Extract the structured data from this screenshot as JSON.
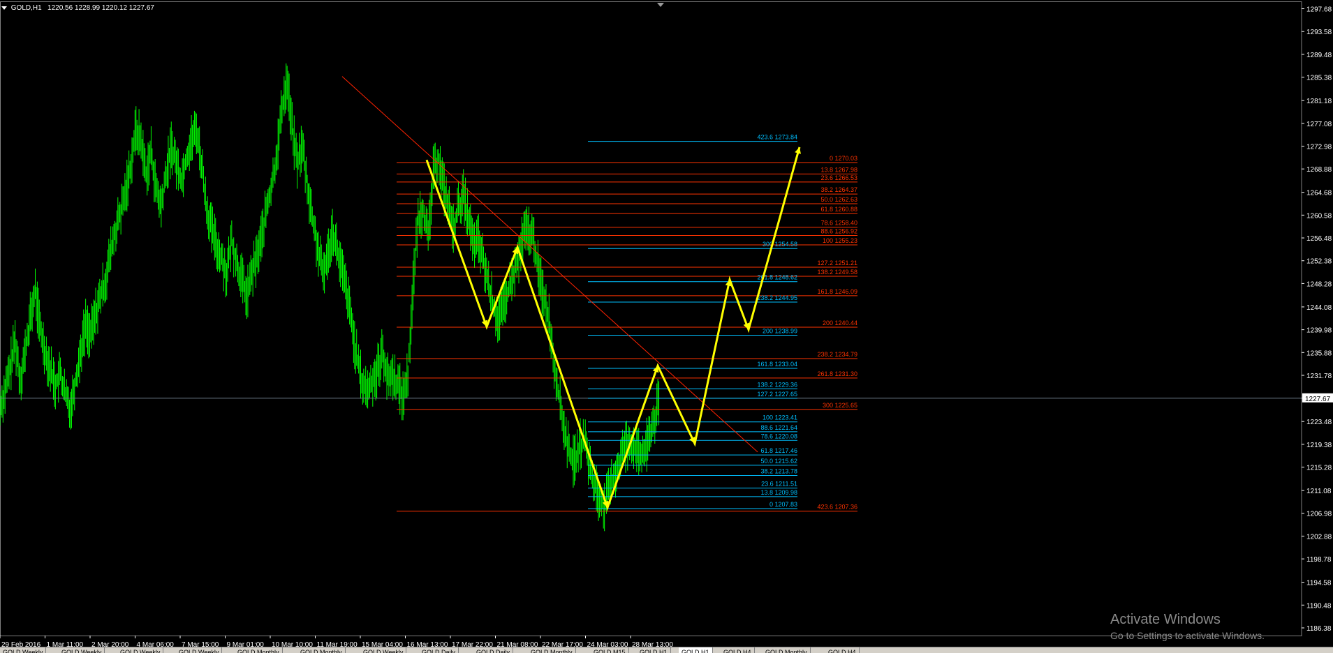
{
  "symbol_label": "GOLD,H1",
  "ohlc_label": "1220.56 1228.99 1220.12 1227.67",
  "current_price_label": "1227.67",
  "watermark": {
    "title": "Activate Windows",
    "subtitle": "Go to Settings to activate Windows."
  },
  "tabs": [
    {
      "label": "GOLD,Weekly",
      "active": false
    },
    {
      "label": "GOLD,Weekly",
      "active": false
    },
    {
      "label": "GOLD,Weekly",
      "active": false
    },
    {
      "label": "GOLD,Weekly",
      "active": false
    },
    {
      "label": "GOLD,Monthly",
      "active": false
    },
    {
      "label": "GOLD,Monthly",
      "active": false
    },
    {
      "label": "GOLD,Weekly",
      "active": false
    },
    {
      "label": "GOLD,Daily",
      "active": false
    },
    {
      "label": "GOLD,Daily",
      "active": false
    },
    {
      "label": "GOLD,Monthly",
      "active": false
    },
    {
      "label": "GOLD,M15",
      "active": false
    },
    {
      "label": "GOLD,H1",
      "active": false
    },
    {
      "label": "GOLD,H1",
      "active": true
    },
    {
      "label": "GOLD,H4",
      "active": false
    },
    {
      "label": "GOLD,Monthly",
      "active": false
    },
    {
      "label": "GOLD,H4",
      "active": false
    }
  ],
  "colors": {
    "background": "#000000",
    "candles": "#00ff00",
    "fib_red": "#ff3300",
    "fib_blue": "#00bfff",
    "zigzag": "#ffff00",
    "trendline": "#ff2200",
    "price_line": "#708090",
    "axis_text": "#ffffff"
  },
  "chart_data": {
    "type": "line",
    "title": "GOLD,H1",
    "ylim": [
      1185.0,
      1299.0
    ],
    "y_ticks": [
      "1297.68",
      "1293.58",
      "1289.48",
      "1285.38",
      "1281.18",
      "1277.08",
      "1272.98",
      "1268.88",
      "1264.68",
      "1260.58",
      "1256.48",
      "1252.38",
      "1248.28",
      "1244.08",
      "1239.98",
      "1235.88",
      "1231.78",
      "1227.67",
      "1223.48",
      "1219.38",
      "1215.28",
      "1211.08",
      "1206.98",
      "1202.88",
      "1198.78",
      "1194.58",
      "1190.48",
      "1186.38"
    ],
    "x_ticks": [
      "29 Feb 2016",
      "1 Mar 11:00",
      "2 Mar 20:00",
      "4 Mar 06:00",
      "7 Mar 15:00",
      "9 Mar 01:00",
      "10 Mar 10:00",
      "11 Mar 19:00",
      "15 Mar 04:00",
      "16 Mar 13:00",
      "17 Mar 22:00",
      "21 Mar 08:00",
      "22 Mar 17:00",
      "24 Mar 03:00",
      "28 Mar 13:00"
    ],
    "current_price": 1227.67,
    "price_path": [
      1226,
      1229,
      1233,
      1238,
      1231,
      1236,
      1242,
      1247,
      1240,
      1236,
      1233,
      1230,
      1232,
      1228,
      1226,
      1231,
      1236,
      1241,
      1239,
      1243,
      1246,
      1249,
      1254,
      1258,
      1261,
      1265,
      1270,
      1276,
      1274,
      1268,
      1272,
      1265,
      1262,
      1268,
      1273,
      1270,
      1267,
      1271,
      1274,
      1276,
      1270,
      1262,
      1258,
      1255,
      1253,
      1250,
      1256,
      1252,
      1249,
      1246,
      1250,
      1253,
      1257,
      1262,
      1266,
      1272,
      1280,
      1285,
      1276,
      1270,
      1273,
      1266,
      1260,
      1255,
      1250,
      1253,
      1258,
      1254,
      1250,
      1246,
      1240,
      1234,
      1230,
      1229,
      1231,
      1233,
      1236,
      1231,
      1232,
      1230,
      1228,
      1232,
      1248,
      1260,
      1262,
      1256,
      1268,
      1271,
      1266,
      1262,
      1258,
      1262,
      1264,
      1260,
      1255,
      1256,
      1252,
      1248,
      1244,
      1242,
      1244,
      1247,
      1250,
      1253,
      1257,
      1258,
      1256,
      1250,
      1246,
      1242,
      1234,
      1228,
      1222,
      1218,
      1216,
      1219,
      1220,
      1216,
      1212,
      1210,
      1208,
      1211,
      1214,
      1216,
      1219,
      1220,
      1219,
      1217,
      1218,
      1221,
      1224,
      1227.67
    ],
    "fib_sets": [
      {
        "name": "red",
        "levels": [
          {
            "level": "0",
            "price": 1270.03
          },
          {
            "level": "13.8",
            "price": 1267.98
          },
          {
            "level": "23.6",
            "price": 1266.53
          },
          {
            "level": "38.2",
            "price": 1264.37
          },
          {
            "level": "50.0",
            "price": 1262.63
          },
          {
            "level": "61.8",
            "price": 1260.88
          },
          {
            "level": "78.6",
            "price": 1258.4
          },
          {
            "level": "88.6",
            "price": 1256.92
          },
          {
            "level": "100",
            "price": 1255.23
          },
          {
            "level": "127.2",
            "price": 1251.21
          },
          {
            "level": "138.2",
            "price": 1249.58
          },
          {
            "level": "161.8",
            "price": 1246.09
          },
          {
            "level": "200",
            "price": 1240.44
          },
          {
            "level": "238.2",
            "price": 1234.79
          },
          {
            "level": "261.8",
            "price": 1231.3
          },
          {
            "level": "300",
            "price": 1225.65
          },
          {
            "level": "423.6",
            "price": 1207.36
          }
        ]
      },
      {
        "name": "blue",
        "levels": [
          {
            "level": "423.6",
            "price": 1273.84
          },
          {
            "level": "300",
            "price": 1254.58
          },
          {
            "level": "261.8",
            "price": 1248.62
          },
          {
            "level": "238.2",
            "price": 1244.95
          },
          {
            "level": "200",
            "price": 1238.99
          },
          {
            "level": "161.8",
            "price": 1233.04
          },
          {
            "level": "138.2",
            "price": 1229.36
          },
          {
            "level": "127.2",
            "price": 1227.65
          },
          {
            "level": "100",
            "price": 1223.41
          },
          {
            "level": "88.6",
            "price": 1221.64
          },
          {
            "level": "78.6",
            "price": 1220.08
          },
          {
            "level": "61.8",
            "price": 1217.46
          },
          {
            "level": "50.0",
            "price": 1215.62
          },
          {
            "level": "38.2",
            "price": 1213.78
          },
          {
            "level": "23.6",
            "price": 1211.51
          },
          {
            "level": "13.8",
            "price": 1209.98
          },
          {
            "level": "0",
            "price": 1207.83
          }
        ]
      }
    ],
    "zigzag_prices": [
      1270.5,
      1240.5,
      1254.8,
      1208.0,
      1233.5,
      1219.5,
      1249.0,
      1240.0,
      1272.8
    ],
    "trendline_prices": [
      1285.5,
      1218.0
    ],
    "grid": false,
    "legend": "none"
  }
}
